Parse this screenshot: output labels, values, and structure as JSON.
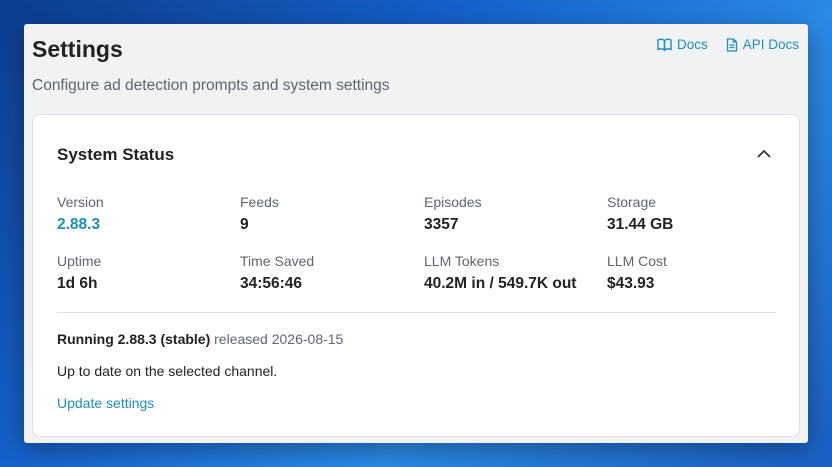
{
  "header": {
    "title": "Settings",
    "subtitle": "Configure ad detection prompts and system settings",
    "links": [
      {
        "label": "Docs",
        "icon": "book-icon"
      },
      {
        "label": "API Docs",
        "icon": "document-icon"
      }
    ]
  },
  "system_status": {
    "title": "System Status",
    "stats": [
      {
        "label": "Version",
        "value": "2.88.3"
      },
      {
        "label": "Feeds",
        "value": "9"
      },
      {
        "label": "Episodes",
        "value": "3357"
      },
      {
        "label": "Storage",
        "value": "31.44 GB"
      },
      {
        "label": "Uptime",
        "value": "1d 6h"
      },
      {
        "label": "Time Saved",
        "value": "34:56:46"
      },
      {
        "label": "LLM Tokens",
        "value": "40.2M in / 549.7K out"
      },
      {
        "label": "LLM Cost",
        "value": "$43.93"
      }
    ],
    "release_strong": "Running 2.88.3 (stable)",
    "release_rest": " released 2026-08-15",
    "status_message": "Up to date on the selected channel.",
    "update_link": "Update settings"
  },
  "colors": {
    "accent": "#1f8fb8",
    "text": "#222222",
    "muted": "#5f6670"
  }
}
